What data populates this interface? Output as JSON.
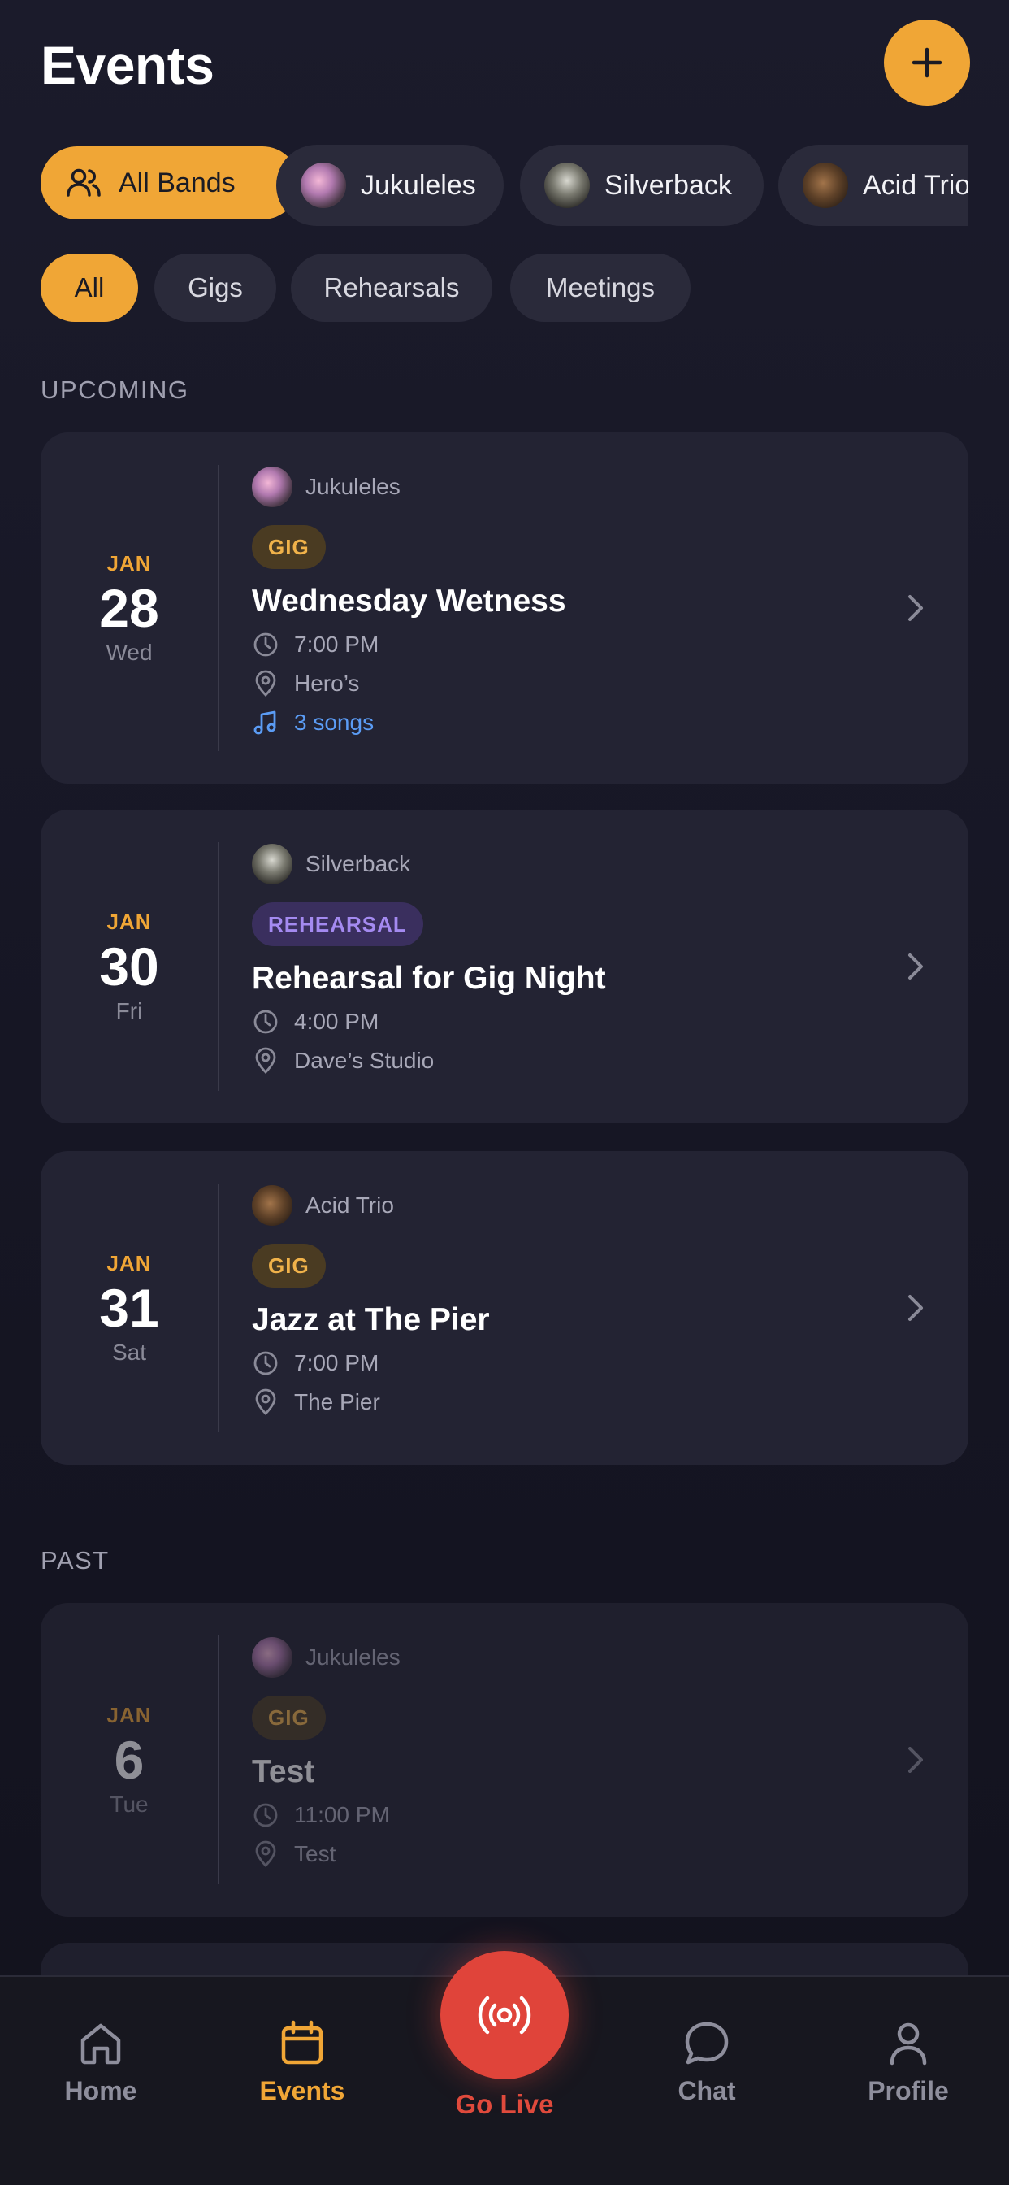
{
  "header": {
    "title": "Events"
  },
  "colors": {
    "accent": "#f0a636",
    "background": "#171725",
    "card": "#232333",
    "live": "#e0443a"
  },
  "band_filters": [
    {
      "label": "All Bands",
      "icon": "users-icon",
      "selected": true
    },
    {
      "label": "Jukuleles",
      "selected": false
    },
    {
      "label": "Silverback",
      "selected": false
    },
    {
      "label": "Acid Trio",
      "selected": false
    }
  ],
  "type_filters": [
    {
      "label": "All",
      "selected": true
    },
    {
      "label": "Gigs",
      "selected": false
    },
    {
      "label": "Rehearsals",
      "selected": false
    },
    {
      "label": "Meetings",
      "selected": false
    }
  ],
  "sections": {
    "upcoming": "UPCOMING",
    "past": "PAST"
  },
  "events": {
    "upcoming": [
      {
        "month": "JAN",
        "day": "28",
        "weekday": "Wed",
        "band": "Jukuleles",
        "type": "GIG",
        "name": "Wednesday Wetness",
        "time": "7:00 PM",
        "location": "Hero’s",
        "songs": "3 songs"
      },
      {
        "month": "JAN",
        "day": "30",
        "weekday": "Fri",
        "band": "Silverback",
        "type": "REHEARSAL",
        "name": "Rehearsal for Gig Night",
        "time": "4:00 PM",
        "location": "Dave’s Studio"
      },
      {
        "month": "JAN",
        "day": "31",
        "weekday": "Sat",
        "band": "Acid Trio",
        "type": "GIG",
        "name": "Jazz at The Pier",
        "time": "7:00 PM",
        "location": "The Pier"
      }
    ],
    "past": [
      {
        "month": "JAN",
        "day": "6",
        "weekday": "Tue",
        "band": "Jukuleles",
        "type": "GIG",
        "name": "Test",
        "time": "11:00 PM",
        "location": "Test"
      }
    ]
  },
  "nav": {
    "home": "Home",
    "events": "Events",
    "golive": "Go Live",
    "chat": "Chat",
    "profile": "Profile"
  }
}
